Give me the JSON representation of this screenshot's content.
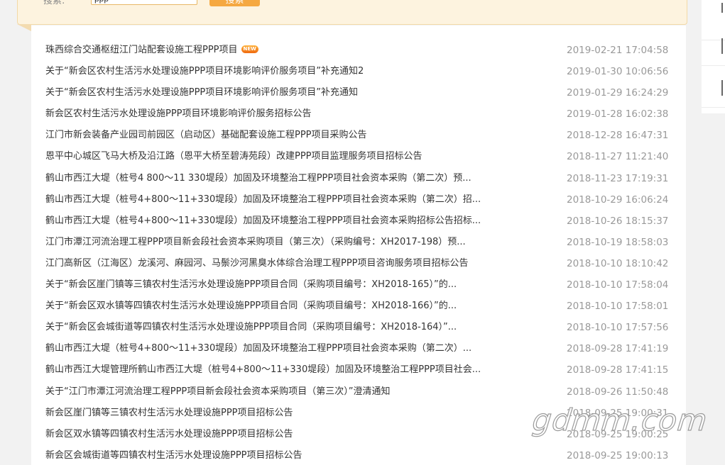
{
  "search": {
    "label": "搜索:",
    "input_value": "ppp",
    "button_label": "搜索"
  },
  "badge_new": "NEW",
  "items": [
    {
      "title": "珠西综合交通枢纽江门站配套设施工程PPP项目",
      "date": "2019-02-21 17:04:58",
      "is_new": true
    },
    {
      "title": "关于“新会区农村生活污水处理设施PPP项目环境影响评价服务项目”补充通知2",
      "date": "2019-01-30 10:06:56"
    },
    {
      "title": "关于“新会区农村生活污水处理设施PPP项目环境影响评价服务项目”补充通知",
      "date": "2019-01-29 16:24:29"
    },
    {
      "title": "新会区农村生活污水处理设施PPP项目环境影响评价服务招标公告",
      "date": "2019-01-28 16:02:38"
    },
    {
      "title": "江门市新会装备产业园司前园区（启动区）基础配套设施工程PPP项目采购公告",
      "date": "2018-12-28 16:47:31"
    },
    {
      "title": "恩平中心城区飞马大桥及沿江路（恩平大桥至碧涛苑段）改建PPP项目监理服务项目招标公告",
      "date": "2018-11-27 11:21:40"
    },
    {
      "title": "鹤山市西江大堤（桩号4 800～11 330堤段）加固及环境整治工程PPP项目社会资本采购（第二次）预...",
      "date": "2018-11-23 17:19:31"
    },
    {
      "title": "鹤山市西江大堤（桩号4+800～11+330堤段）加固及环境整治工程PPP项目社会资本采购（第二次）招...",
      "date": "2018-10-29 16:06:24"
    },
    {
      "title": "鹤山市西江大堤（桩号4+800～11+330堤段）加固及环境整治工程PPP项目社会资本采购招标公告招标...",
      "date": "2018-10-26 18:15:37"
    },
    {
      "title": "江门市潭江河流治理工程PPP项目新会段社会资本采购项目（第三次）（采购编号：XH2017-198）预...",
      "date": "2018-10-19 18:58:03"
    },
    {
      "title": "江门高新区（江海区）龙溪河、麻园河、马鬃沙河黑臭水体综合治理工程PPP项目咨询服务项目招标公告",
      "date": "2018-10-10 18:10:42"
    },
    {
      "title": "关于“新会区崖门镇等三镇农村生活污水处理设施PPP项目合同（采购项目编号：XH2018-165）”的...",
      "date": "2018-10-10 17:58:04"
    },
    {
      "title": "关于“新会区双水镇等四镇农村生活污水处理设施PPP项目合同（采购项目编号：XH2018-166）”的...",
      "date": "2018-10-10 17:58:01"
    },
    {
      "title": "关于“新会区会城街道等四镇农村生活污水处理设施PPP项目合同（采购项目编号：XH2018-164）”...",
      "date": "2018-10-10 17:57:56"
    },
    {
      "title": "鹤山市西江大堤（桩号4+800～11+330堤段）加固及环境整治工程PPP项目社会资本采购（第二次）...",
      "date": "2018-09-28 17:41:19"
    },
    {
      "title": "鹤山市西江大堤管理所鹤山市西江大堤（桩号4+800～11+330堤段）加固及环境整治工程PPP项目社会...",
      "date": "2018-09-28 17:41:15"
    },
    {
      "title": "关于“江门市潭江河流治理工程PPP项目新会段社会资本采购项目（第三次）”澄清通知",
      "date": "2018-09-26 11:50:48"
    },
    {
      "title": "新会区崖门镇等三镇农村生活污水处理设施PPP项目招标公告",
      "date": "2018-09-25 19:00:31"
    },
    {
      "title": "新会区双水镇等四镇农村生活污水处理设施PPP项目招标公告",
      "date": "2018-09-25 19:00:25"
    },
    {
      "title": "新会区会城街道等四镇农村生活污水处理设施PPP项目招标公告",
      "date": "2018-09-25 19:00:13"
    }
  ],
  "watermark": "gdmm.com"
}
